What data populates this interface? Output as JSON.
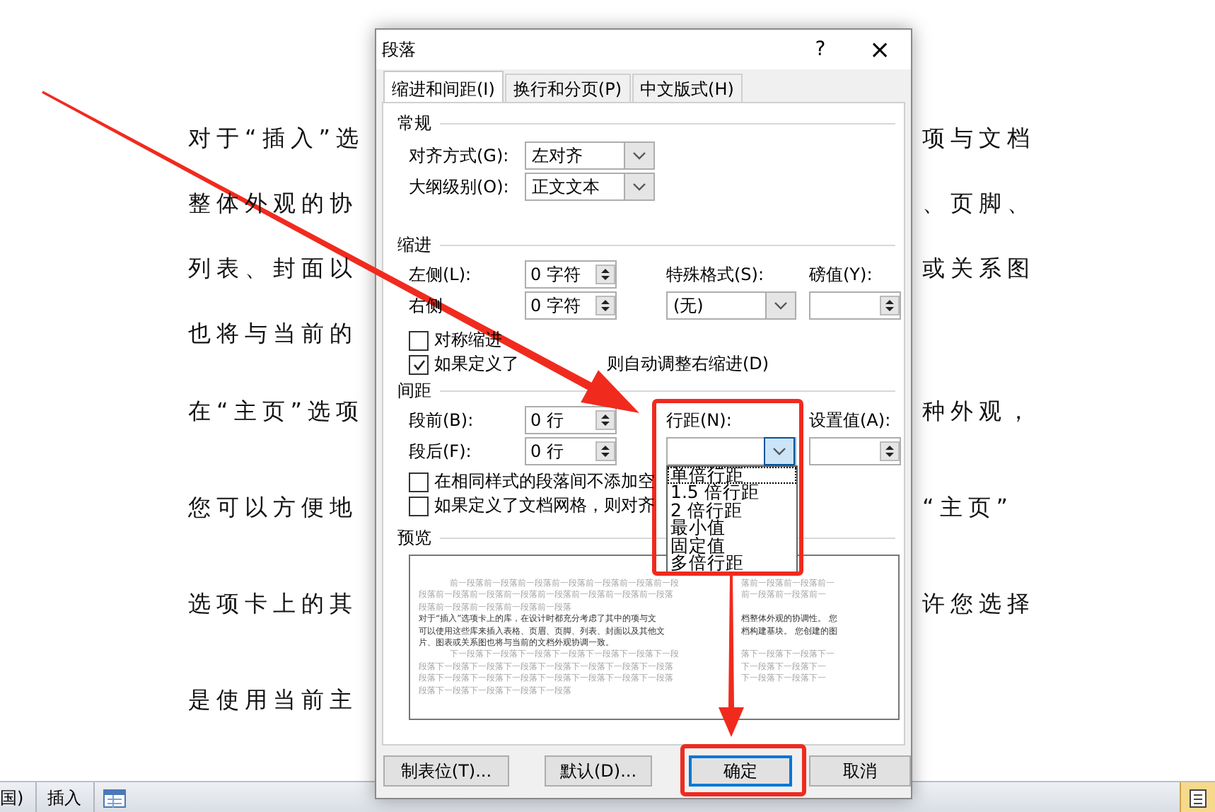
{
  "document": {
    "lines": [
      {
        "left": "对于“插入”选",
        "right": "项与文档"
      },
      {
        "left": "整体外观的协",
        "right": "、页脚、"
      },
      {
        "left": "列表、封面以",
        "right": "或关系图"
      },
      {
        "left": "也将与当前的"
      },
      {
        "left": "在“主页”选项",
        "right": "种外观，"
      },
      {
        "left": "您可以方便地",
        "right": "“主页”"
      },
      {
        "left": "选项卡上的其",
        "right": "许您选择"
      },
      {
        "left": "是使用当前主"
      }
    ]
  },
  "dialog": {
    "title": "段落",
    "help": "?",
    "close": "×",
    "tabs": [
      {
        "label": "缩进和间距(I)",
        "selected": true
      },
      {
        "label": "换行和分页(P)",
        "selected": false
      },
      {
        "label": "中文版式(H)",
        "selected": false
      }
    ],
    "general": {
      "heading": "常规",
      "fields": [
        {
          "label": "对齐方式(G):",
          "value": "左对齐"
        },
        {
          "label": "大纲级别(O):",
          "value": "正文文本"
        }
      ]
    },
    "indent": {
      "heading": "缩进",
      "left": {
        "label": "左侧(L):",
        "value": "0 字符"
      },
      "right": {
        "label": "右侧",
        "value": "0 字符"
      },
      "special": {
        "label": "特殊格式(S):",
        "value": "(无)"
      },
      "by": {
        "label": "磅值(Y):"
      },
      "checkboxes": [
        {
          "label": "对称缩进",
          "checked": false
        },
        {
          "label": "如果定义了",
          "label_end": "则自动调整右缩进(D)",
          "checked": true
        }
      ]
    },
    "spacing": {
      "heading": "间距",
      "before": {
        "label": "段前(B):",
        "value": "0 行"
      },
      "after": {
        "label": "段后(F):",
        "value": "0 行"
      },
      "line_spacing": {
        "label": "行距(N):",
        "expanded": true,
        "options": [
          {
            "label": "单倍行距",
            "selected": true
          },
          {
            "label": "1.5 倍行距",
            "selected": false
          },
          {
            "label": "2 倍行距",
            "selected": false
          },
          {
            "label": "最小值",
            "selected": false
          },
          {
            "label": "固定值",
            "selected": false
          },
          {
            "label": "多倍行距",
            "selected": false
          }
        ]
      },
      "at": {
        "label": "设置值(A):"
      },
      "checkboxes": [
        {
          "label": "在相同样式的段落间不添加空",
          "checked": false
        },
        {
          "label": "如果定义了文档网格，则对齐",
          "checked": false
        }
      ]
    },
    "preview": {
      "heading": "预览",
      "rows": [
        {
          "kind": "previous",
          "left": "前一段落前一段落前一段落前一段落前一段落前一段落前一段",
          "right": "落前一段落前一段落前一"
        },
        {
          "kind": "previous",
          "left": "段落前一段落前一段落前一段落前一段落前一段落前一段落前一段落",
          "right": "前一段落前一段落前一"
        },
        {
          "kind": "previous",
          "left": "段落前一段落前一段落前一段落前一段落"
        },
        {
          "kind": "sample",
          "left": "对于“插入”选项卡上的库，在设计时都充分考虑了其中的项与文",
          "right": "档整体外观的协调性。 您"
        },
        {
          "kind": "sample",
          "left": "可以使用这些库来插入表格、页眉、页脚、列表、封面以及其他文",
          "right": "档构建基块。 您创建的图"
        },
        {
          "kind": "sample",
          "left": "片、图表或关系图也将与当前的文档外观协调一致。"
        },
        {
          "kind": "next",
          "left": "下一段落下一段落下一段落下一段落下一段落下一段落下一段",
          "right": "落下一段落下一段落下一"
        },
        {
          "kind": "next",
          "left": "段落下一段落下一段落下一段落下一段落下一段落下一段落下一段落",
          "right": "下一段落下一段落下一"
        },
        {
          "kind": "next",
          "left": "段落下一段落下一段落下一段落下一段落下一段落下一段落下一段落",
          "right": "下一段落下一段落下一"
        },
        {
          "kind": "next",
          "left": "段落下一段落下一段落下一段落下一段落"
        }
      ]
    },
    "buttons": [
      {
        "label": "制表位(T)...",
        "default": false
      },
      {
        "label": "默认(D)...",
        "default": false
      },
      {
        "label": "确定",
        "default": true
      },
      {
        "label": "取消",
        "default": false
      }
    ]
  },
  "status_bar": {
    "items": [
      "国)",
      "插入"
    ]
  }
}
